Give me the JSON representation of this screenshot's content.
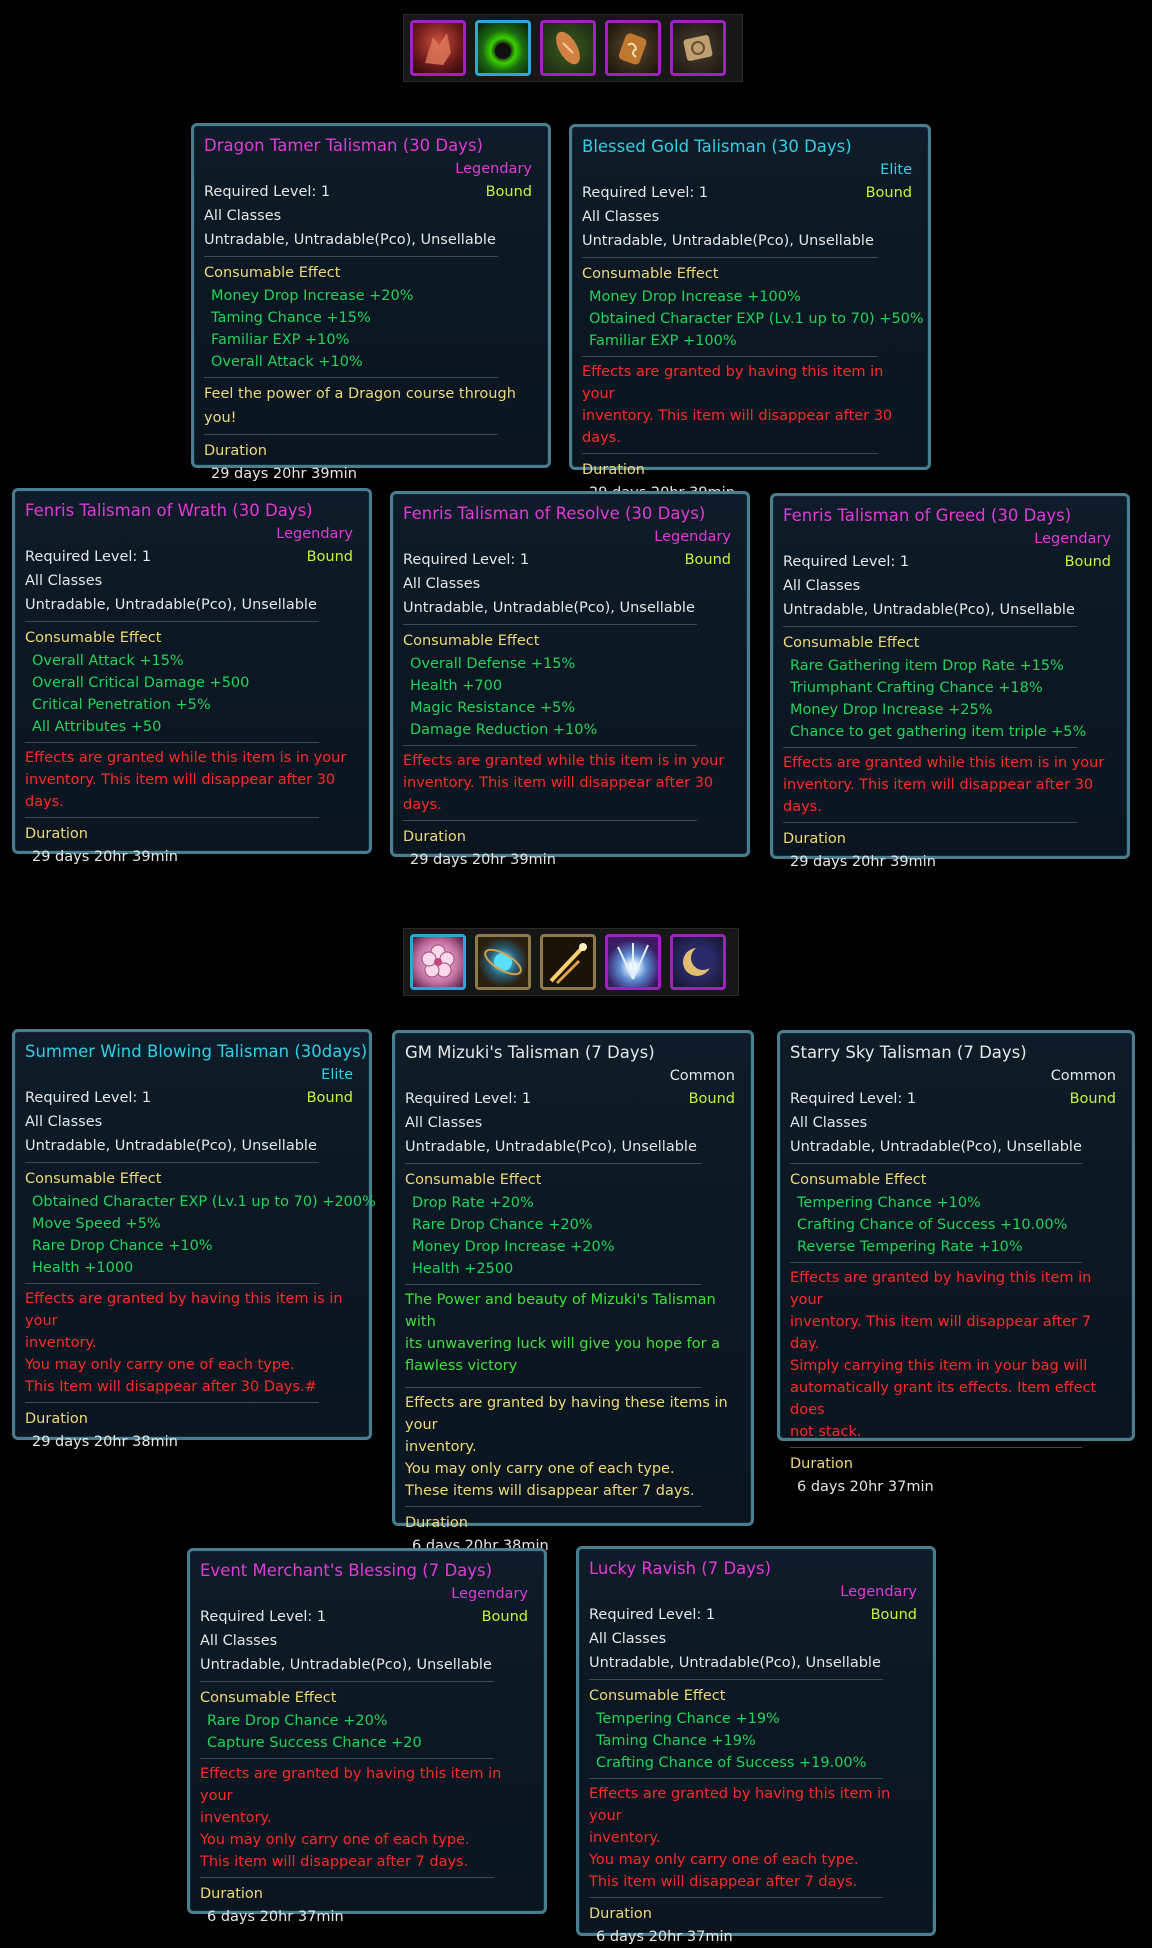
{
  "colors": {
    "legendary": "#e23ad8",
    "elite": "#2fd0e6",
    "common": "#e6e6e6",
    "bound": "#c6f33a",
    "effect": "#22d35a",
    "header": "#f0d878",
    "warning": "#ff2a2a"
  },
  "icons_top": [
    "red-dragon-icon",
    "golden-aura-icon",
    "orange-talisman-icon",
    "rune-charm-icon",
    "gold-tablet-icon"
  ],
  "icons_bottom": [
    "pink-flower-icon",
    "blue-orb-icon",
    "shooting-star-icon",
    "blue-explosion-icon",
    "crescent-moon-icon"
  ],
  "common": {
    "req": "Required Level: 1",
    "bound": "Bound",
    "classes": "All Classes",
    "trade": "Untradable, Untradable(Pco), Unsellable",
    "consumable": "Consumable Effect",
    "duration": "Duration"
  },
  "cards": [
    {
      "title": "Dragon Tamer Talisman (30 Days)",
      "grade": "Legendary",
      "effects": [
        "Money Drop Increase +20%",
        "Taming Chance +15%",
        "Familiar EXP +10%",
        "Overall Attack +10%"
      ],
      "note_yellow": "Feel the power of a Dragon course through you!",
      "time": "29 days 20hr 39min"
    },
    {
      "title": "Blessed Gold Talisman (30 Days)",
      "grade": "Elite",
      "effects": [
        "Money Drop Increase +100%",
        "Obtained Character EXP (Lv.1 up to 70) +50%",
        "Familiar EXP +100%"
      ],
      "warn": [
        "Effects are granted by having this item in your",
        "inventory. This item will disappear after 30 days."
      ],
      "time": "29 days 20hr 39min"
    },
    {
      "title": "Fenris Talisman of Wrath (30 Days)",
      "grade": "Legendary",
      "effects": [
        "Overall Attack +15%",
        "Overall Critical Damage +500",
        "Critical Penetration +5%",
        "All Attributes +50"
      ],
      "warn": [
        "Effects are granted while this item is in your",
        "inventory. This item will disappear after 30 days."
      ],
      "time": "29 days 20hr 39min"
    },
    {
      "title": "Fenris Talisman of Resolve (30 Days)",
      "grade": "Legendary",
      "effects": [
        "Overall Defense +15%",
        "Health +700",
        "Magic Resistance +5%",
        "Damage Reduction +10%"
      ],
      "warn": [
        "Effects are granted while this item is in your",
        "inventory. This item will disappear after 30 days."
      ],
      "time": "29 days 20hr 39min"
    },
    {
      "title": "Fenris Talisman of Greed (30 Days)",
      "grade": "Legendary",
      "effects": [
        "Rare Gathering item Drop Rate +15%",
        "Triumphant Crafting Chance +18%",
        "Money Drop Increase +25%",
        "Chance to get gathering item triple +5%"
      ],
      "warn": [
        "Effects are granted while this item is in your",
        "inventory. This item will disappear after 30 days."
      ],
      "time": "29 days 20hr 39min"
    },
    {
      "title": "Summer Wind Blowing Talisman (30days)",
      "grade": "Elite",
      "effects": [
        "Obtained Character EXP (Lv.1 up to 70) +200%",
        "Move Speed +5%",
        "Rare Drop Chance +10%",
        "Health +1000"
      ],
      "warn": [
        "Effects are granted by having this item is in your",
        "inventory.",
        "You may only carry one of each type.",
        "This Item will disappear after 30 Days.#"
      ],
      "time": "29 days 20hr 38min"
    },
    {
      "title": "GM Mizuki's Talisman (7 Days)",
      "grade": "Common",
      "effects": [
        "Drop Rate +20%",
        "Rare Drop Chance +20%",
        "Money Drop Increase +20%",
        "Health +2500"
      ],
      "note_green": [
        "The Power and beauty of Mizuki's Talisman with",
        "its unwavering luck will give you hope for a",
        "flawless victory"
      ],
      "note_yellow_lines": [
        "Effects are granted by having these items in your",
        "inventory.",
        "You may only carry one of each type.",
        "These items will disappear after 7 days."
      ],
      "time": "6 days 20hr 38min"
    },
    {
      "title": "Starry Sky Talisman (7 Days)",
      "grade": "Common",
      "effects": [
        "Tempering Chance +10%",
        "Crafting Chance of Success +10.00%",
        "Reverse Tempering Rate +10%"
      ],
      "warn": [
        "Effects are granted by having this item in your",
        "inventory. This item will disappear after 7 day.",
        "Simply carrying this item in your bag will",
        "automatically grant its effects. Item effect does",
        "not stack."
      ],
      "time": "6 days 20hr 37min"
    },
    {
      "title": "Event Merchant's Blessing (7 Days)",
      "grade": "Legendary",
      "effects": [
        "Rare Drop Chance +20%",
        "Capture Success Chance +20"
      ],
      "warn": [
        "Effects are granted by having this item in your",
        "inventory.",
        "You may only carry one of each type.",
        "This item will disappear after 7 days."
      ],
      "time": "6 days 20hr 37min"
    },
    {
      "title": "Lucky Ravish (7 Days)",
      "grade": "Legendary",
      "effects": [
        "Tempering Chance +19%",
        "Taming Chance +19%",
        "Crafting Chance of Success +19.00%"
      ],
      "warn": [
        "Effects are granted by having this item in your",
        "inventory.",
        "You may only carry one of each type.",
        "This item will disappear after 7 days."
      ],
      "time": "6 days 20hr 37min"
    }
  ]
}
